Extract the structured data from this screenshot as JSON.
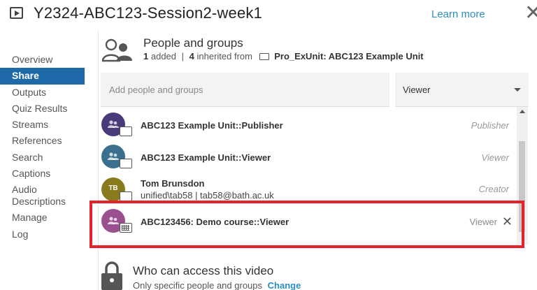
{
  "header": {
    "title": "Y2324-ABC123-Session2-week1",
    "learn_more": "Learn more",
    "close_glyph": "✕"
  },
  "sidebar": {
    "items": [
      {
        "label": "Overview",
        "active": false
      },
      {
        "label": "Share",
        "active": true
      },
      {
        "label": "Outputs",
        "active": false
      },
      {
        "label": "Quiz Results",
        "active": false
      },
      {
        "label": "Streams",
        "active": false
      },
      {
        "label": "References",
        "active": false
      },
      {
        "label": "Search",
        "active": false
      },
      {
        "label": "Captions",
        "active": false
      },
      {
        "label": "Audio Descriptions",
        "active": false
      },
      {
        "label": "Manage",
        "active": false
      },
      {
        "label": "Log",
        "active": false
      }
    ]
  },
  "people_groups": {
    "title": "People and groups",
    "added_count": "1",
    "added_label": "added",
    "separator": "|",
    "inherited_count": "4",
    "inherited_label": "inherited from",
    "unit_name": "Pro_ExUnit: ABC123 Example Unit"
  },
  "add_field": {
    "placeholder": "Add people and groups",
    "role_value": "Viewer"
  },
  "list": {
    "rows": [
      {
        "name": "ABC123 Example Unit::Publisher",
        "detail": "",
        "role": "Publisher",
        "avatar_color": "#4a3a7a",
        "kind": "group-folder"
      },
      {
        "name": "ABC123 Example Unit::Viewer",
        "detail": "",
        "role": "Viewer",
        "avatar_color": "#3b6f8e",
        "kind": "group-folder"
      },
      {
        "name": "Tom Brunsdon",
        "detail": "unified\\tab58 | tab58@bath.ac.uk",
        "role": "Creator",
        "avatar_color": "#8a7a1e",
        "initials": "TB",
        "kind": "user-folder"
      },
      {
        "name": "ABC123456: Demo course::Viewer",
        "detail": "",
        "role": "Viewer",
        "avatar_color": "#9a4f8e",
        "kind": "group-course",
        "removable": true
      }
    ]
  },
  "access": {
    "title": "Who can access this video",
    "subtitle": "Only specific people and groups",
    "change_label": "Change"
  },
  "colors": {
    "accent": "#1e6aa8",
    "link": "#2a8fc0",
    "highlight": "#e3222a"
  }
}
